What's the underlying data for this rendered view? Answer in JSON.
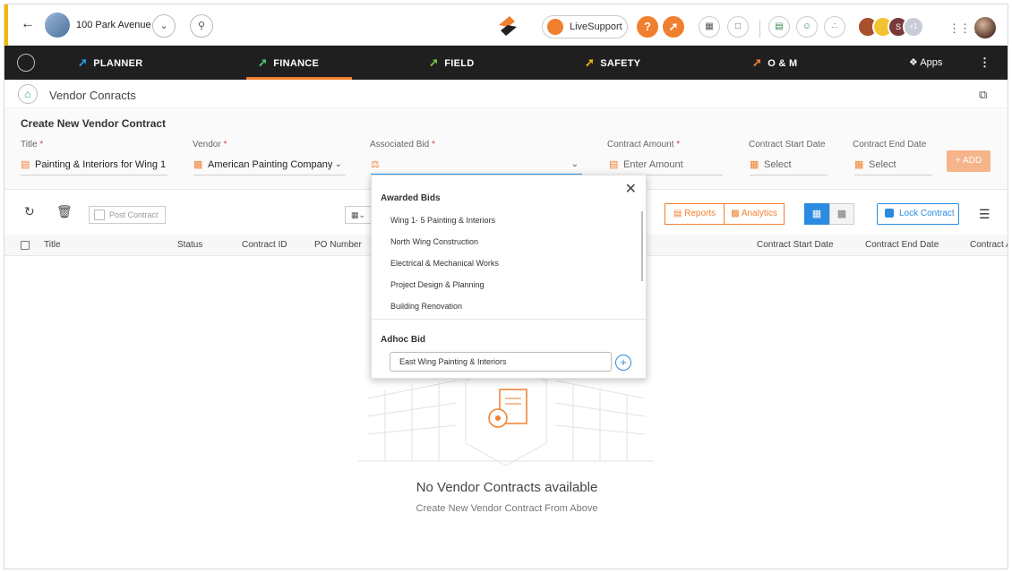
{
  "top": {
    "project_name": "100 Park Avenue",
    "live_support": "LiveSupport",
    "help_icon": "?",
    "user_badge": "S",
    "user_count": "+1",
    "accent_color": "#f07f2f"
  },
  "nav": {
    "items": [
      {
        "label": "PLANNER",
        "arrow_color": "#2a9cf0"
      },
      {
        "label": "FINANCE",
        "arrow_color": "#4cc76b"
      },
      {
        "label": "FIELD",
        "arrow_color": "#7ac943"
      },
      {
        "label": "SAFETY",
        "arrow_color": "#f2b705"
      },
      {
        "label": "O & M",
        "arrow_color": "#f07f2f"
      }
    ],
    "apps": "Apps",
    "active": "FINANCE"
  },
  "page": {
    "title": "Vendor Conracts"
  },
  "form": {
    "title": "Create New Vendor Contract",
    "fields": {
      "title": {
        "label": "Title",
        "value": "Painting & Interiors for Wing 1"
      },
      "vendor": {
        "label": "Vendor",
        "value": "American Painting Company"
      },
      "bid": {
        "label": "Associated Bid",
        "value": ""
      },
      "amount": {
        "label": "Contract Amount",
        "placeholder": "Enter Amount"
      },
      "start": {
        "label": "Contract Start Date",
        "placeholder": "Select"
      },
      "end": {
        "label": "Contract End Date",
        "placeholder": "Select"
      }
    },
    "add_label": "+ ADD"
  },
  "toolbar": {
    "post_contract": "Post Contract",
    "reports": "Reports",
    "analytics": "Analytics",
    "lock_contract": "Lock Contract"
  },
  "table": {
    "columns_left": [
      "Title",
      "Status",
      "Contract ID",
      "PO Number"
    ],
    "columns_right": [
      "Contract Start Date",
      "Contract End Date",
      "Contract A"
    ]
  },
  "empty": {
    "title": "No Vendor Contracts available",
    "subtitle": "Create New Vendor Contract From Above"
  },
  "dropdown": {
    "awarded_title": "Awarded Bids",
    "awarded_items": [
      "Wing 1- 5 Painting & Interiors",
      "North Wing Construction",
      "Electrical & Mechanical Works",
      "Project Design & Planning",
      "Building Renovation"
    ],
    "adhoc_title": "Adhoc Bid",
    "adhoc_value": "East Wing Painting & Interiors"
  }
}
